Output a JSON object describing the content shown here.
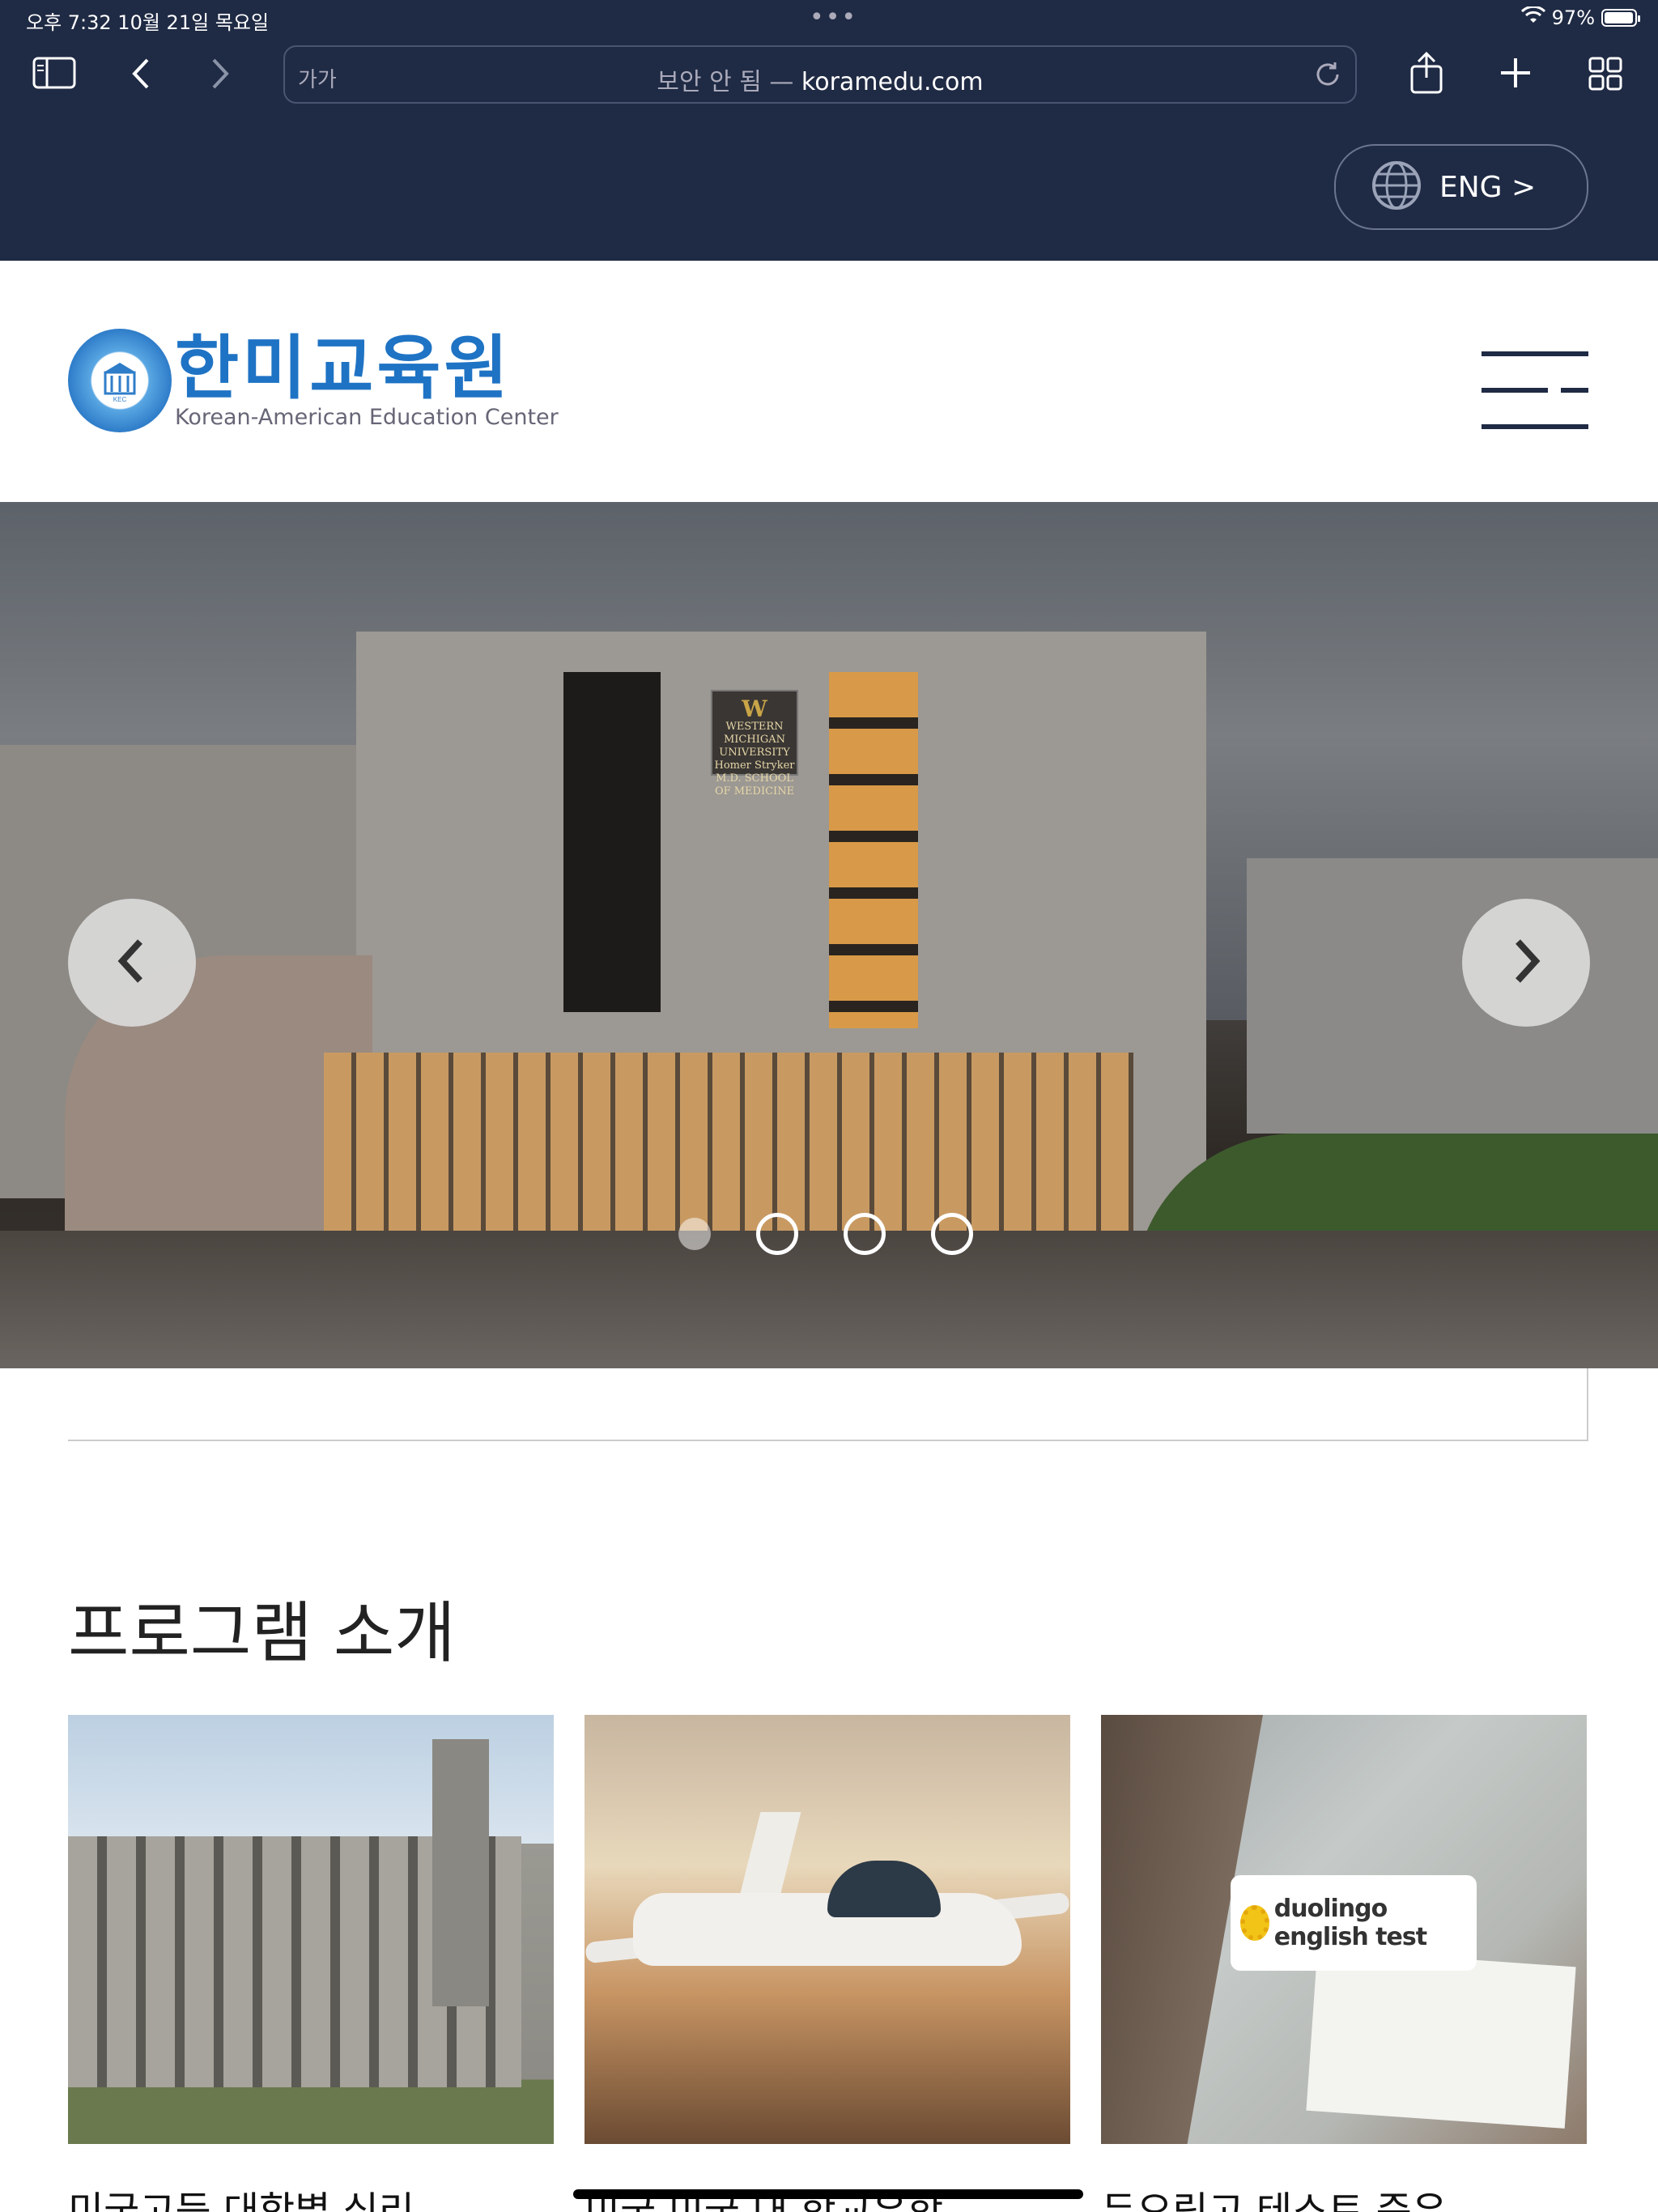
{
  "status_bar": {
    "time_date": "오후 7:32   10월 21일 목요일",
    "dots": "•••",
    "battery": "97%",
    "battery_level": 0.97
  },
  "browser": {
    "text_size_label": "가가",
    "url_prefix": "보안 안 됨 — ",
    "url_domain": "koramedu.com",
    "icons": [
      "sidebar-icon",
      "back-icon",
      "forward-icon",
      "reload-icon",
      "share-icon",
      "new-tab-icon",
      "tabs-overview-icon"
    ]
  },
  "language": {
    "label": "ENG >",
    "icon": "globe-icon"
  },
  "header": {
    "logo_ko": "한미교육원",
    "logo_en": "Korean-American Education Center",
    "logo_badge": "KEC",
    "menu_icon": "hamburger-icon"
  },
  "slider": {
    "sign_w": "W",
    "sign_lines": "WESTERN MICHIGAN UNIVERSITY Homer Stryker M.D. SCHOOL OF MEDICINE",
    "slide_count": 4,
    "active_index": 0,
    "prev_icon": "chevron-left-icon",
    "next_icon": "chevron-right-icon"
  },
  "programs": {
    "title": "프로그램 소개",
    "cards": [
      {
        "image_label": "university-building",
        "caption": "미국고등 대학별 심리"
      },
      {
        "image_label": "airplane",
        "caption": "미국 미국 내 학교유학"
      },
      {
        "image_label": "duolingo",
        "badge": "duolingo english test",
        "caption": "듀오링고 테스트 준유"
      }
    ]
  },
  "colors": {
    "chrome_bg": "#1f2a44",
    "logo_blue": "#1f73c4",
    "text_dark": "#222222"
  }
}
